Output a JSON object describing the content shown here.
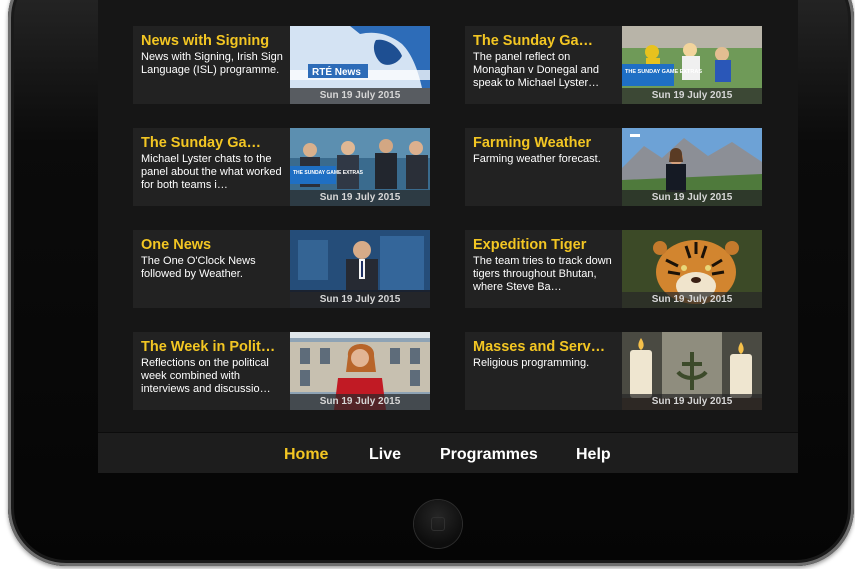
{
  "tiles": [
    {
      "title": "News with Signing",
      "description": "News with Signing, Irish Sign Language (ISL) programme.",
      "date": "Sun 19 July 2015",
      "thumb": "rte-news-map-icon",
      "thumb_caption": "RTÉ News"
    },
    {
      "title": "The Sunday Ga…",
      "description": "The panel reflect on Monaghan v Donegal and speak to Michael Lyster…",
      "date": "Sun 19 July 2015",
      "thumb": "football-match-icon",
      "thumb_caption": "THE SUNDAY GAME EXTRAS"
    },
    {
      "title": "The Sunday Ga…",
      "description": "Michael Lyster chats to the panel about the what worked for both teams i…",
      "date": "Sun 19 July 2015",
      "thumb": "studio-panel-icon",
      "thumb_caption": "THE SUNDAY GAME EXTRAS"
    },
    {
      "title": "Farming Weather",
      "description": "Farming weather forecast.",
      "date": "Sun 19 July 2015",
      "thumb": "weather-presenter-icon"
    },
    {
      "title": "One News",
      "description": "The One O'Clock News followed by Weather.",
      "date": "Sun 19 July 2015",
      "thumb": "news-anchor-icon"
    },
    {
      "title": "Expedition Tiger",
      "description": "The team tries to track down tigers throughout Bhutan, where Steve Ba…",
      "date": "Sun 19 July 2015",
      "thumb": "tiger-icon"
    },
    {
      "title": "The Week in Polit…",
      "description": "Reflections on the political week combined with interviews and discussio…",
      "date": "Sun 19 July 2015",
      "thumb": "politics-presenter-icon"
    },
    {
      "title": "Masses and Serv…",
      "description": "Religious programming.",
      "date": "Sun 19 July 2015",
      "thumb": "candles-icon"
    }
  ],
  "nav": {
    "items": [
      "Home",
      "Live",
      "Programmes",
      "Help"
    ],
    "active": "Home"
  },
  "colors": {
    "accent": "#f3c623",
    "screen_bg": "#161616",
    "tile_bg": "#222222"
  }
}
